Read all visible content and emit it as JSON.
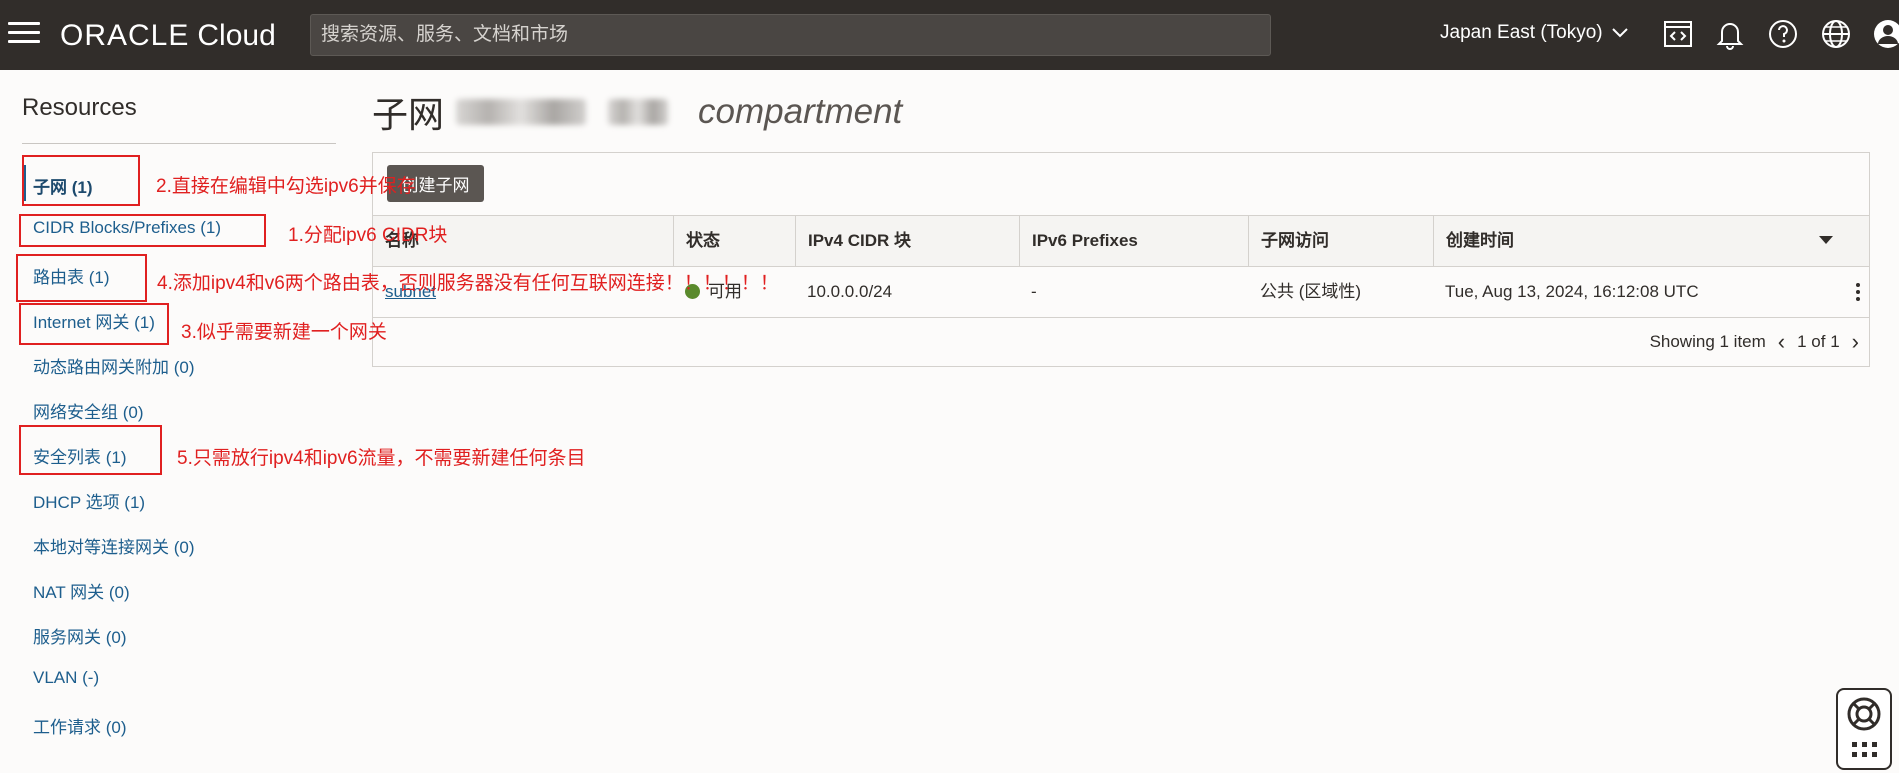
{
  "header": {
    "logo_oracle": "ORACLE",
    "logo_cloud": "Cloud",
    "search_placeholder": "搜索资源、服务、文档和市场",
    "region": "Japan East (Tokyo)",
    "icons": [
      "menu-icon",
      "code-editor-icon",
      "bell-icon",
      "help-icon",
      "globe-icon",
      "user-avatar-icon"
    ]
  },
  "sidebar": {
    "title": "Resources",
    "items": [
      {
        "label": "子网 (1)",
        "active": true
      },
      {
        "label": "CIDR Blocks/Prefixes (1)"
      },
      {
        "label": "路由表 (1)"
      },
      {
        "label": "Internet 网关 (1)"
      },
      {
        "label": "动态路由网关附加 (0)"
      },
      {
        "label": "网络安全组 (0)"
      },
      {
        "label": "安全列表 (1)"
      },
      {
        "label": "DHCP 选项 (1)"
      },
      {
        "label": "本地对等连接网关 (0)"
      },
      {
        "label": "NAT 网关 (0)"
      },
      {
        "label": "服务网关 (0)"
      },
      {
        "label": "VLAN (-)"
      },
      {
        "label": "工作请求 (0)"
      }
    ]
  },
  "main": {
    "title": "子网",
    "title_suffix": "compartment",
    "create_button": "创建子网",
    "columns": [
      "名称",
      "状态",
      "IPv4 CIDR 块",
      "IPv6 Prefixes",
      "子网访问",
      "创建时间"
    ],
    "rows": [
      {
        "name": "subnet",
        "status": "可用",
        "ipv4": "10.0.0.0/24",
        "ipv6": "-",
        "access": "公共 (区域性)",
        "created": "Tue, Aug 13, 2024, 16:12:08 UTC"
      }
    ],
    "showing": "Showing 1 item",
    "page": "1 of 1"
  },
  "annotations": {
    "a1": "1.分配ipv6 CIDR块",
    "a2": "2.直接在编辑中勾选ipv6并保存",
    "a3": "3.似乎需要新建一个网关",
    "a4": "4.添加ipv4和v6两个路由表，否则服务器没有任何互联网连接！！！！！！",
    "a5": "5.只需放行ipv4和ipv6流量，不需要新建任何条目"
  },
  "colors": {
    "header_bg": "#312d2a",
    "link": "#1d5e8d",
    "annotation_red": "#e02020",
    "status_green": "#5a8a2c"
  }
}
